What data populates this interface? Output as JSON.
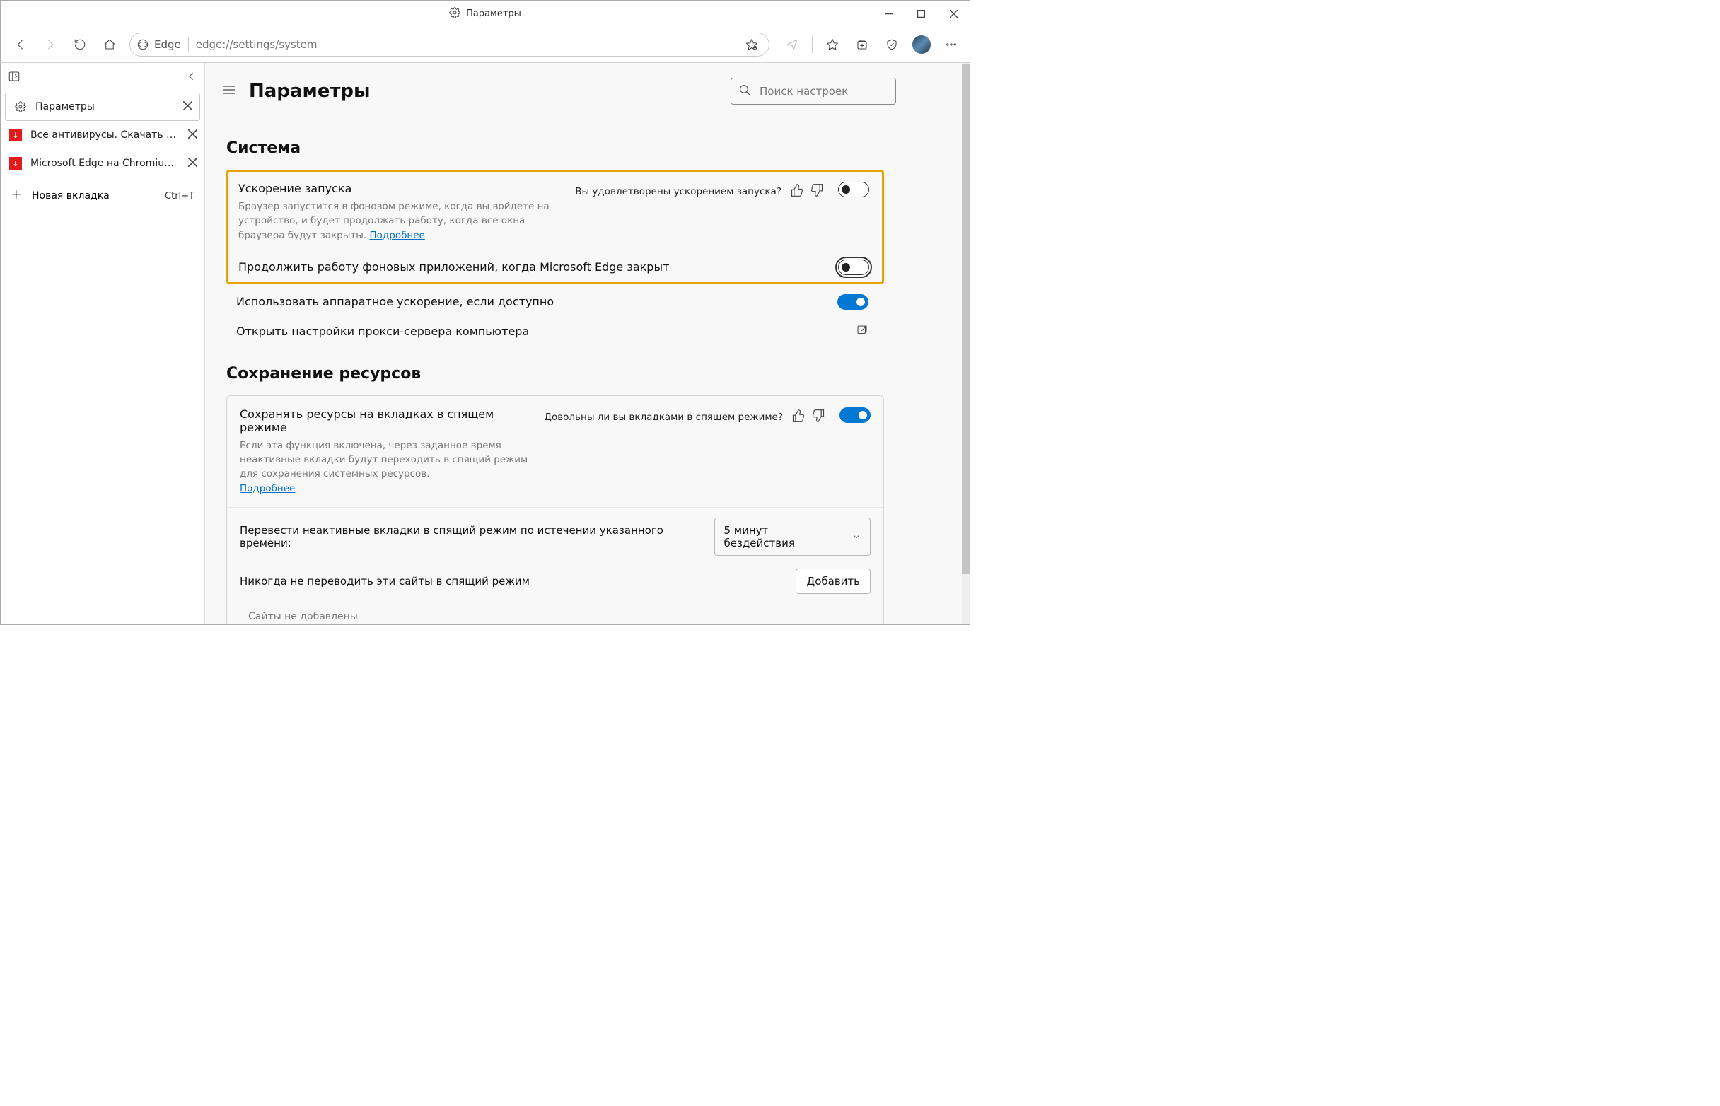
{
  "window": {
    "title": "Параметры"
  },
  "addressbar": {
    "badge": "Edge",
    "url": "edge://settings/system"
  },
  "sidebar": {
    "tabs": [
      {
        "label": "Параметры",
        "active": true
      },
      {
        "label": "Все антивирусы. Скачать беспл…"
      },
      {
        "label": "Microsoft Edge на Chromium – H…"
      }
    ],
    "newtab_label": "Новая вкладка",
    "newtab_shortcut": "Ctrl+T"
  },
  "header": {
    "title": "Параметры",
    "search_placeholder": "Поиск настроек"
  },
  "system": {
    "heading": "Система",
    "startup": {
      "title": "Ускорение запуска",
      "desc": "Браузер запустится в фоновом режиме, когда вы войдете на устройство, и будет продолжать работу, когда все окна браузера будут закрыты. ",
      "more": "Подробнее",
      "feedback_text": "Вы удовлетворены ускорением запуска?"
    },
    "background_apps": {
      "title": "Продолжить работу фоновых приложений, когда Microsoft Edge закрыт"
    },
    "hw_accel": {
      "title": "Использовать аппаратное ускорение, если доступно"
    },
    "proxy": {
      "title": "Открыть настройки прокси-сервера компьютера"
    }
  },
  "resources": {
    "heading": "Сохранение ресурсов",
    "sleep_tabs": {
      "title": "Сохранять ресурсы на вкладках в спящем режиме",
      "desc": "Если эта функция включена, через заданное время неактивные вкладки будут переходить в спящий режим для сохранения системных ресурсов. ",
      "more": "Подробнее",
      "feedback_text": "Довольны ли вы вкладками в спящем режиме?"
    },
    "timeout": {
      "label": "Перевести неактивные вкладки в спящий режим по истечении указанного времени:",
      "value": "5 минут бездействия"
    },
    "never_sleep": {
      "label": "Никогда не переводить эти сайты в спящий режим",
      "add_button": "Добавить",
      "empty": "Сайты не добавлены"
    }
  }
}
